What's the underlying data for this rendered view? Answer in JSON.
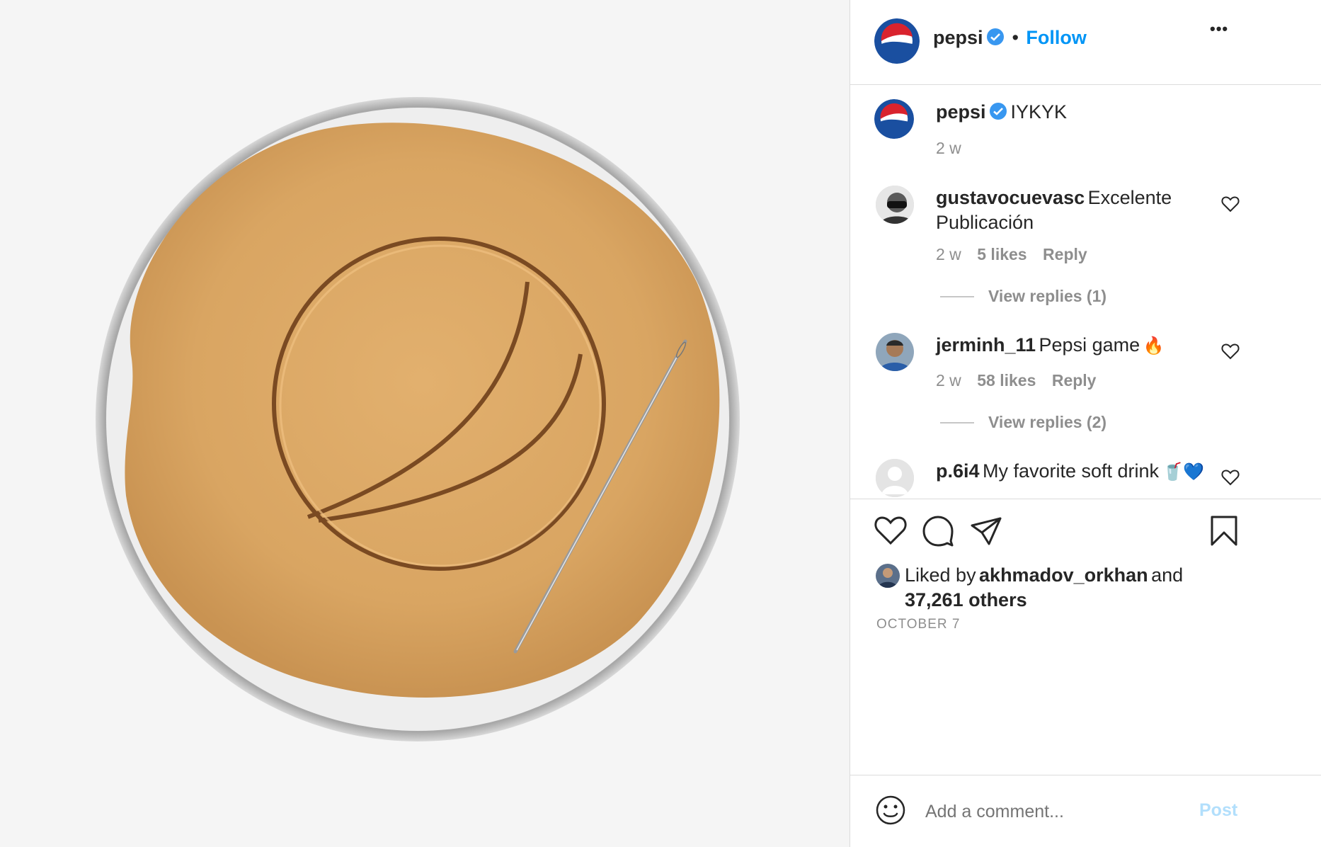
{
  "header": {
    "username": "pepsi",
    "separator": "•",
    "follow_label": "Follow",
    "more_label": "•••"
  },
  "caption": {
    "username": "pepsi",
    "text": "IYKYK",
    "time": "2 w"
  },
  "comments": [
    {
      "username": "gustavocuevasc",
      "text_line1": "Excelente",
      "text_line2": "Publicación",
      "time": "2 w",
      "likes": "5 likes",
      "reply_label": "Reply",
      "view_replies": "View replies (1)"
    },
    {
      "username": "jerminh_11",
      "text": "Pepsi game",
      "emoji": "🔥",
      "time": "2 w",
      "likes": "58 likes",
      "reply_label": "Reply",
      "view_replies": "View replies (2)"
    },
    {
      "username": "p.6i4",
      "text": "My favorite soft drink",
      "emoji": "🥤💙"
    }
  ],
  "likes": {
    "prefix": "Liked by",
    "user": "akhmadov_orkhan",
    "connector": "and",
    "others": "37,261 others"
  },
  "date": "OCTOBER 7",
  "comment_box": {
    "placeholder": "Add a comment...",
    "post_label": "Post"
  },
  "colors": {
    "accent": "#0095f6",
    "post_disabled": "#b2dffc",
    "verified": "#3897f0",
    "pepsi_blue": "#1a4fa0",
    "pepsi_red": "#d9232e",
    "dalgona": "#dba865"
  },
  "icons": [
    "verified-icon",
    "more-icon",
    "heart-icon",
    "comment-icon",
    "share-icon",
    "bookmark-icon",
    "emoji-icon",
    "pepsi-logo-icon",
    "needle-icon"
  ]
}
